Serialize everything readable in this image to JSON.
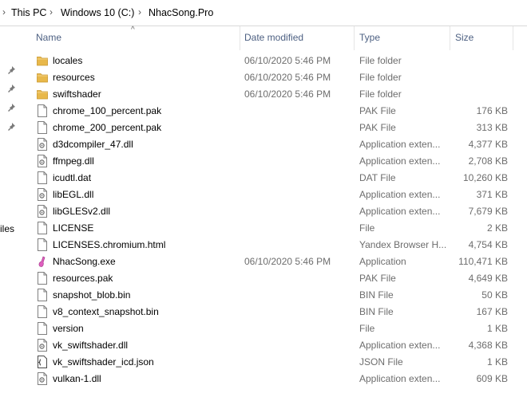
{
  "breadcrumb": [
    "This PC",
    "Windows 10 (C:)",
    "NhacSong.Pro"
  ],
  "nav_label": "iles",
  "columns": {
    "name": "Name",
    "date": "Date modified",
    "type": "Type",
    "size": "Size"
  },
  "files": [
    {
      "name": "locales",
      "date": "06/10/2020 5:46 PM",
      "type": "File folder",
      "size": "",
      "icon": "folder-icon"
    },
    {
      "name": "resources",
      "date": "06/10/2020 5:46 PM",
      "type": "File folder",
      "size": "",
      "icon": "folder-icon"
    },
    {
      "name": "swiftshader",
      "date": "06/10/2020 5:46 PM",
      "type": "File folder",
      "size": "",
      "icon": "folder-icon"
    },
    {
      "name": "chrome_100_percent.pak",
      "date": "",
      "type": "PAK File",
      "size": "176 KB",
      "icon": "file-icon"
    },
    {
      "name": "chrome_200_percent.pak",
      "date": "",
      "type": "PAK File",
      "size": "313 KB",
      "icon": "file-icon"
    },
    {
      "name": "d3dcompiler_47.dll",
      "date": "",
      "type": "Application exten...",
      "size": "4,377 KB",
      "icon": "dll-icon"
    },
    {
      "name": "ffmpeg.dll",
      "date": "",
      "type": "Application exten...",
      "size": "2,708 KB",
      "icon": "dll-icon"
    },
    {
      "name": "icudtl.dat",
      "date": "",
      "type": "DAT File",
      "size": "10,260 KB",
      "icon": "file-icon"
    },
    {
      "name": "libEGL.dll",
      "date": "",
      "type": "Application exten...",
      "size": "371 KB",
      "icon": "dll-icon"
    },
    {
      "name": "libGLESv2.dll",
      "date": "",
      "type": "Application exten...",
      "size": "7,679 KB",
      "icon": "dll-icon"
    },
    {
      "name": "LICENSE",
      "date": "",
      "type": "File",
      "size": "2 KB",
      "icon": "file-icon"
    },
    {
      "name": "LICENSES.chromium.html",
      "date": "",
      "type": "Yandex Browser H...",
      "size": "4,754 KB",
      "icon": "file-icon"
    },
    {
      "name": "NhacSong.exe",
      "date": "06/10/2020 5:46 PM",
      "type": "Application",
      "size": "110,471 KB",
      "icon": "app-icon"
    },
    {
      "name": "resources.pak",
      "date": "",
      "type": "PAK File",
      "size": "4,649 KB",
      "icon": "file-icon"
    },
    {
      "name": "snapshot_blob.bin",
      "date": "",
      "type": "BIN File",
      "size": "50 KB",
      "icon": "file-icon"
    },
    {
      "name": "v8_context_snapshot.bin",
      "date": "",
      "type": "BIN File",
      "size": "167 KB",
      "icon": "file-icon"
    },
    {
      "name": "version",
      "date": "",
      "type": "File",
      "size": "1 KB",
      "icon": "file-icon"
    },
    {
      "name": "vk_swiftshader.dll",
      "date": "",
      "type": "Application exten...",
      "size": "4,368 KB",
      "icon": "dll-icon"
    },
    {
      "name": "vk_swiftshader_icd.json",
      "date": "",
      "type": "JSON File",
      "size": "1 KB",
      "icon": "json-icon"
    },
    {
      "name": "vulkan-1.dll",
      "date": "",
      "type": "Application exten...",
      "size": "609 KB",
      "icon": "dll-icon"
    }
  ],
  "colors": {
    "header_text": "#4d6082",
    "folder": "#e8b84a",
    "muted_text": "#6d6d6d"
  }
}
